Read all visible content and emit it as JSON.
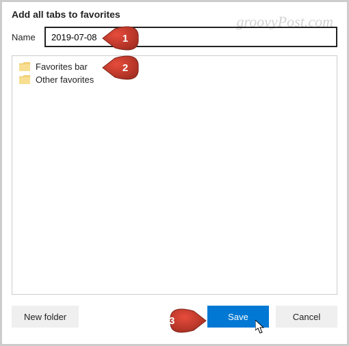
{
  "title": "Add all tabs to favorites",
  "name_label": "Name",
  "name_value": "2019-07-08",
  "folders": [
    {
      "label": "Favorites bar"
    },
    {
      "label": "Other favorites"
    }
  ],
  "buttons": {
    "new_folder": "New folder",
    "save": "Save",
    "cancel": "Cancel"
  },
  "watermark": "groovyPost.com",
  "callouts": [
    "1",
    "2",
    "3"
  ],
  "colors": {
    "primary": "#0078d4",
    "callout": "#c0392b"
  }
}
